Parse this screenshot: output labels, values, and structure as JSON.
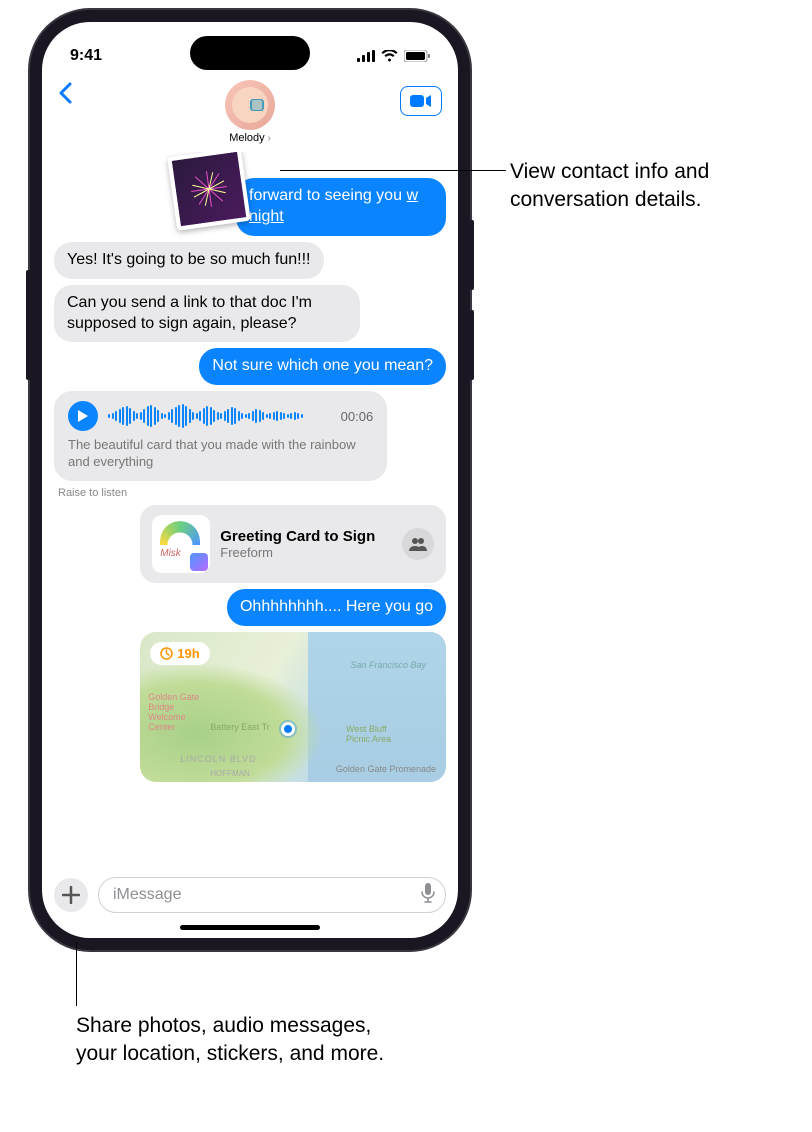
{
  "status": {
    "time": "9:41"
  },
  "nav": {
    "contact_name": "Melody"
  },
  "messages": {
    "m1_partial": "forward to seeing you",
    "m1_link": "w night",
    "m2": "Yes! It's going to be so much fun!!!",
    "m3": "Can you send a link to that doc I'm supposed to sign again, please?",
    "m4": "Not sure which one you mean?",
    "audio_duration": "00:06",
    "audio_transcript": "The beautiful card that you made with the rainbow and everything",
    "raise_to_listen": "Raise to listen",
    "card_title": "Greeting Card to Sign",
    "card_sub": "Freeform",
    "m5": "Ohhhhhhhh.... Here you go",
    "map_time": "19h"
  },
  "map_labels": {
    "bay": "San Francisco Bay",
    "ggb": "Golden Gate Bridge Welcome Center",
    "battery": "Battery East Tr",
    "westbluff": "West Bluff Picnic Area",
    "prom": "Golden Gate Promenade",
    "lincoln": "LINCOLN BLVD",
    "hoffman": "HOFFMAN"
  },
  "input": {
    "placeholder": "iMessage"
  },
  "callouts": {
    "c1": "View contact info and conversation details.",
    "c2": "Share photos, audio messages, your location, stickers, and more."
  }
}
